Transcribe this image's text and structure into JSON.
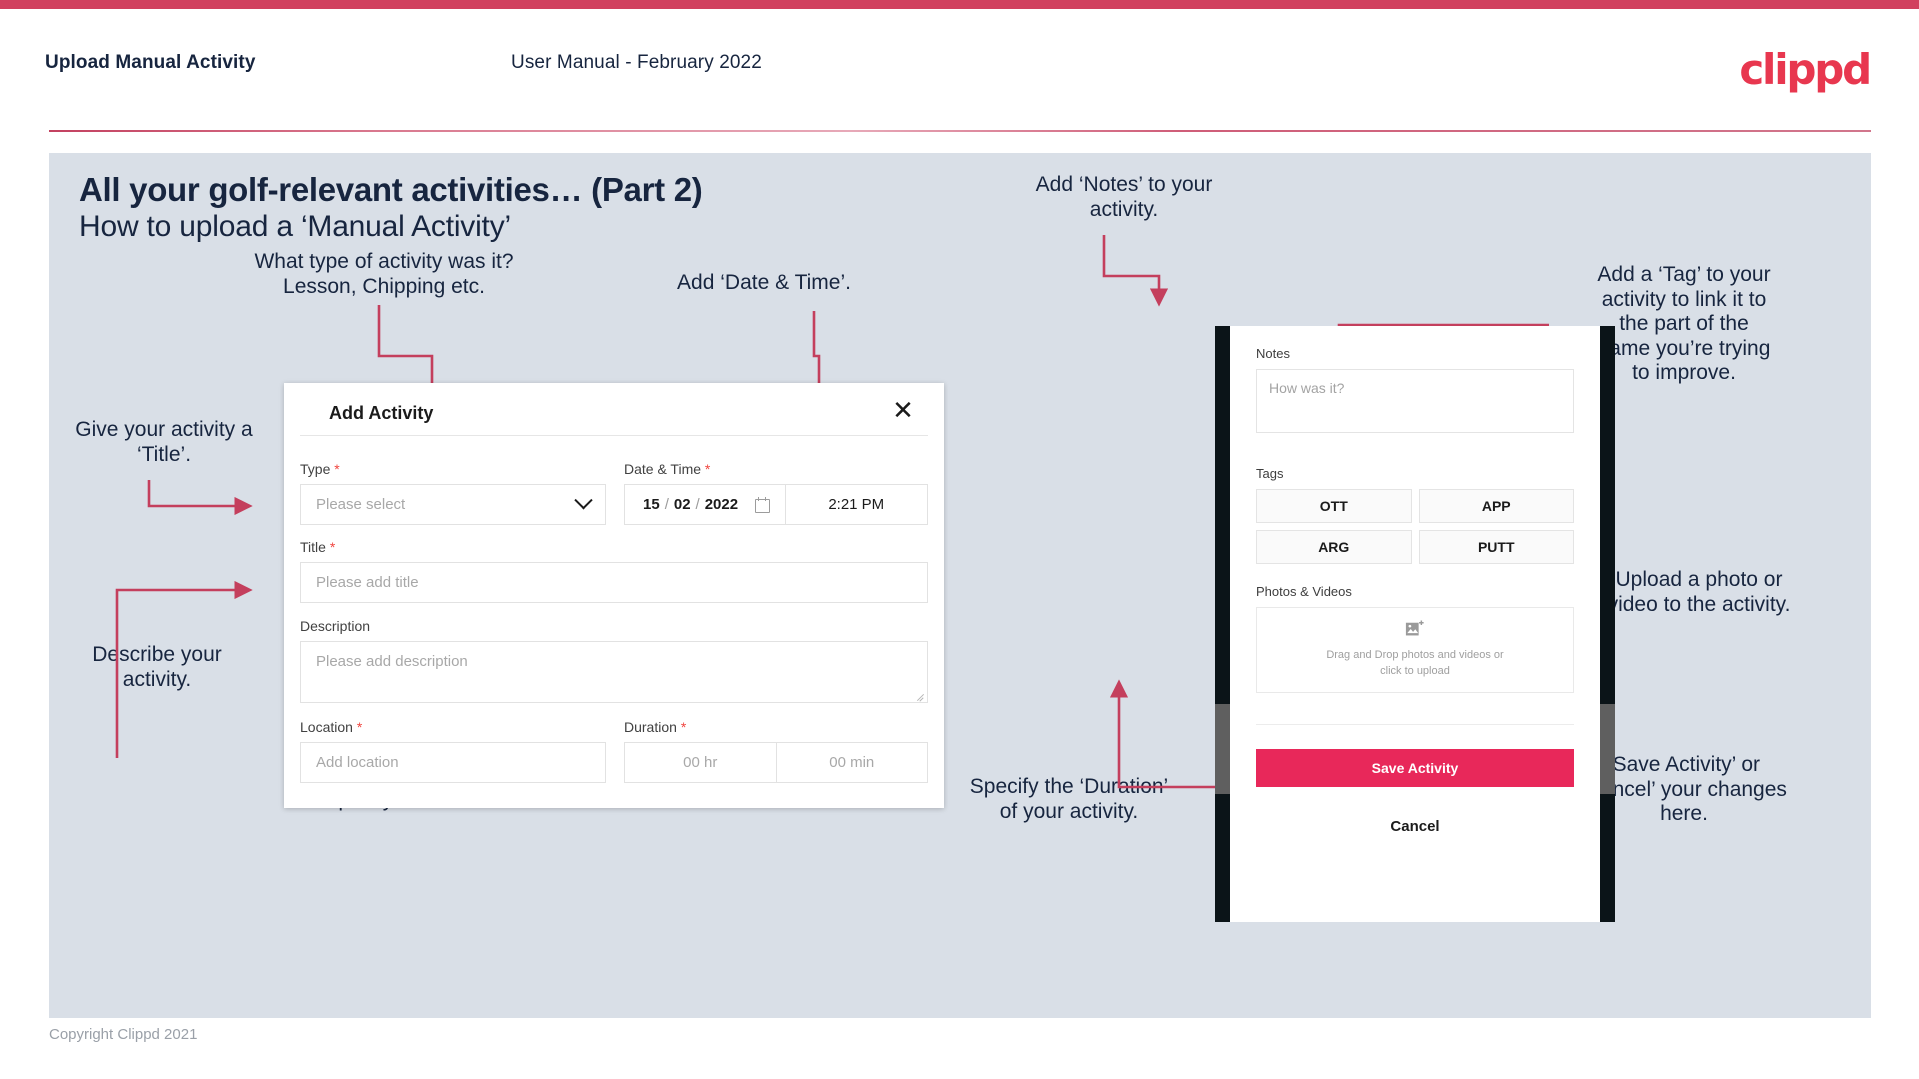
{
  "header": {
    "title": "Upload Manual Activity",
    "subtitle": "User Manual - February 2022",
    "logo": "clippd"
  },
  "slide": {
    "title": "All your golf-relevant activities… (Part 2)",
    "subtitle": "How to upload a ‘Manual Activity’"
  },
  "annotations": {
    "type": "What type of activity was it?\nLesson, Chipping etc.",
    "date_time": "Add ‘Date & Time’.",
    "title_field": "Give your activity a\n‘Title’.",
    "description": "Describe your\nactivity.",
    "location": "Specify the ‘Location’.",
    "duration": "Specify the ‘Duration’\nof your activity.",
    "notes": "Add ‘Notes’ to your\nactivity.",
    "tags": "Add a ‘Tag’ to your\nactivity to link it to\nthe part of the\ngame you’re trying\nto improve.",
    "upload": "Upload a photo or\nvideo to the activity.",
    "save_cancel": "‘Save Activity’ or\n‘Cancel’ your changes\nhere."
  },
  "modal": {
    "title": "Add Activity",
    "close_icon": "close-icon",
    "fields": {
      "type": {
        "label": "Type",
        "required": "*",
        "placeholder": "Please select"
      },
      "datetime": {
        "label": "Date & Time",
        "required": "*",
        "day": "15",
        "month": "02",
        "year": "2022",
        "sep": "/",
        "time": "2:21 PM"
      },
      "title": {
        "label": "Title",
        "required": "*",
        "placeholder": "Please add title"
      },
      "description": {
        "label": "Description",
        "placeholder": "Please add description"
      },
      "location": {
        "label": "Location",
        "required": "*",
        "placeholder": "Add location"
      },
      "duration": {
        "label": "Duration",
        "required": "*",
        "hours": "00 hr",
        "minutes": "00 min"
      }
    }
  },
  "phone": {
    "notes": {
      "label": "Notes",
      "placeholder": "How was it?"
    },
    "tags": {
      "label": "Tags",
      "items": [
        "OTT",
        "APP",
        "ARG",
        "PUTT"
      ]
    },
    "photos": {
      "label": "Photos & Videos",
      "dropzone_line1": "Drag and Drop photos and videos or",
      "dropzone_line2": "click to upload",
      "icon": "add-image-icon"
    },
    "save_label": "Save Activity",
    "cancel_label": "Cancel"
  },
  "footer": {
    "copyright": "Copyright Clippd 2021"
  },
  "colors": {
    "accent": "#d1415f",
    "brand": "#e8374f",
    "save_button": "#e8285a",
    "slide_bg": "#d9dfe7",
    "text_dark": "#17253f",
    "connector": "#c43f5d"
  }
}
